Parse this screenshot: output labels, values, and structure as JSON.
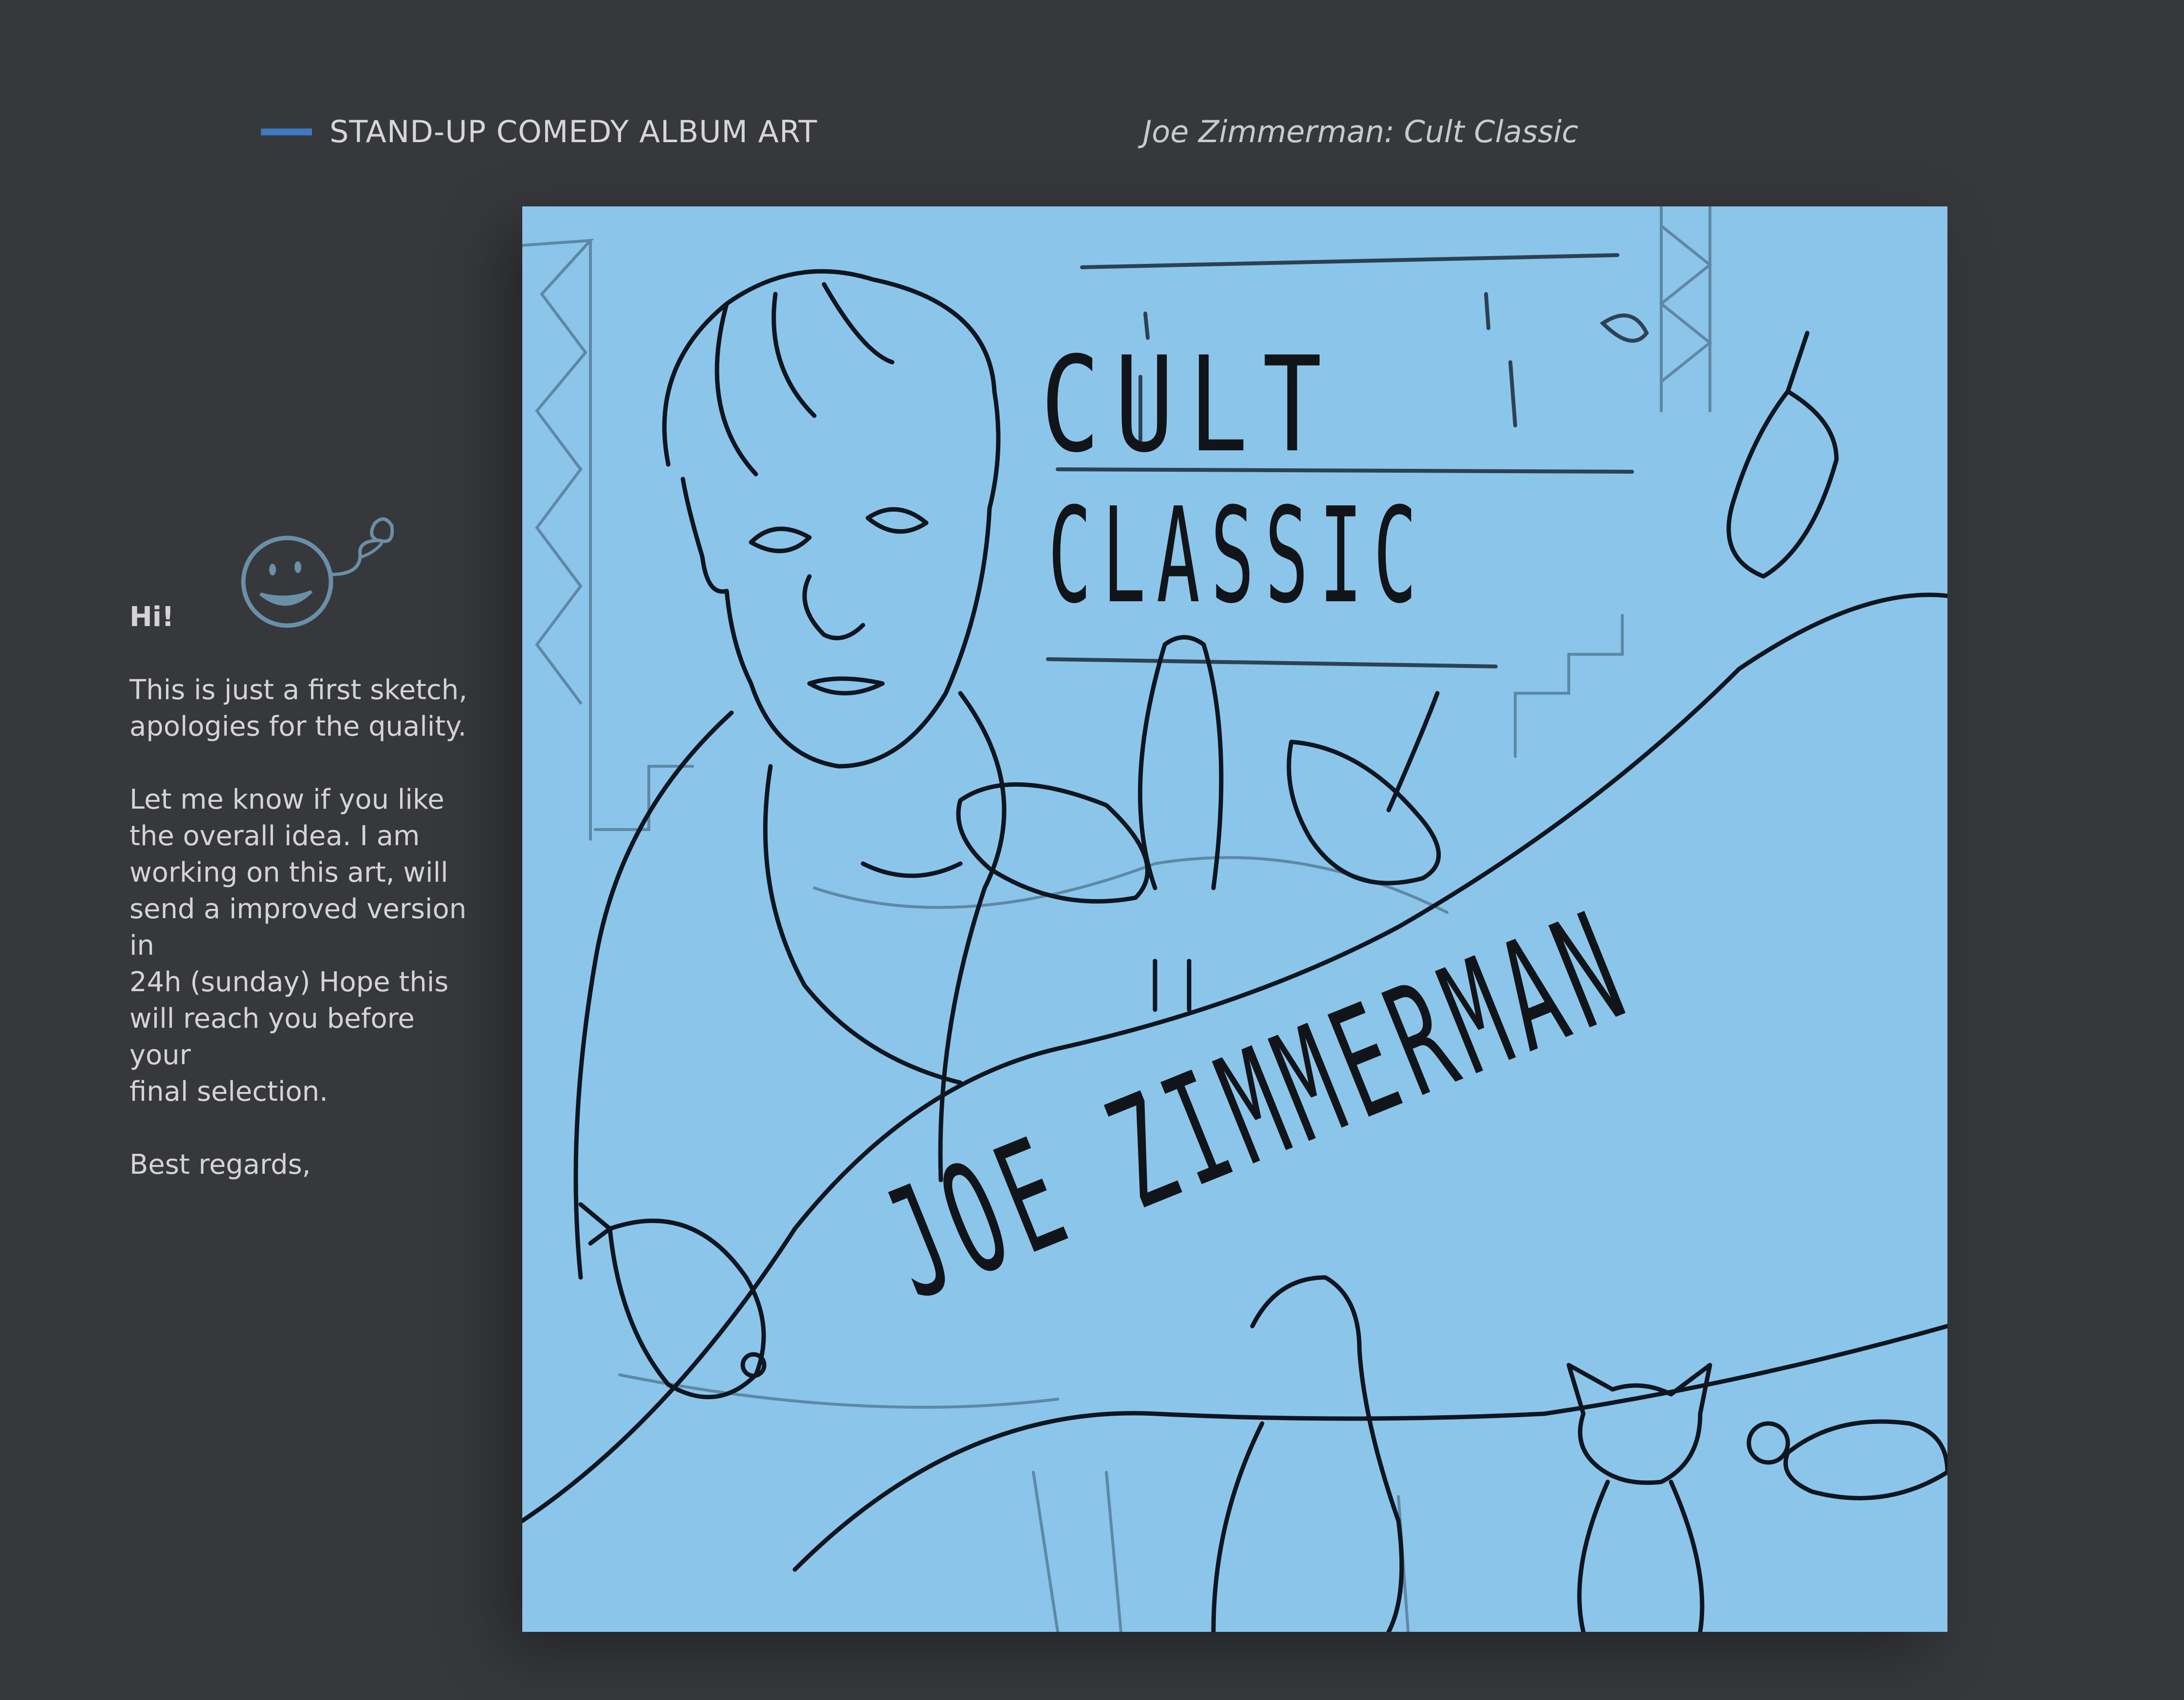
{
  "header": {
    "category_label": "STAND-UP COMEDY ALBUM ART",
    "project_title": "Joe Zimmerman: Cult Classic",
    "accent_color": "#3d7ac0"
  },
  "note": {
    "greeting": "Hi!",
    "paragraph_1": "This is just a first sketch,\napologies for the quality.",
    "paragraph_2": "Let me know if you like\nthe overall idea. I am\nworking on this art, will\nsend a improved version in\n24h (sunday) Hope this\nwill reach you before your\nfinal selection.",
    "sign_off": "Best regards,",
    "icon": "smiley-face-icon"
  },
  "artwork": {
    "title_line_1": "CULT",
    "title_line_2": "CLASSIC",
    "artist_name": "JOE ZIMMERMAN",
    "background_color": "#8cc5ea",
    "ink_color": "#111418"
  }
}
